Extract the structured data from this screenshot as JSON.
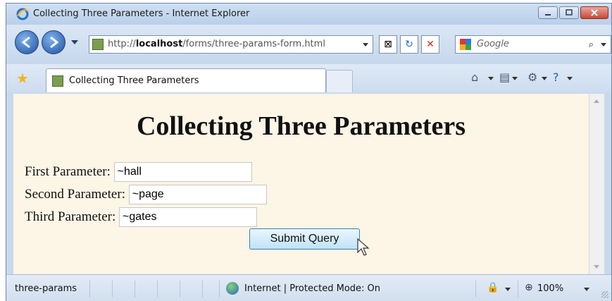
{
  "window": {
    "title": "Collecting Three Parameters - Internet Explorer",
    "controls": {
      "minimize": "minimize",
      "maximize": "maximize",
      "close": "close"
    }
  },
  "address_bar": {
    "url_prefix": "http://",
    "url_host": "localhost",
    "url_path": "/forms/three-params-form.html"
  },
  "search": {
    "placeholder": "Google"
  },
  "tab": {
    "label": "Collecting Three Parameters"
  },
  "page": {
    "heading": "Collecting Three Parameters",
    "fields": [
      {
        "label": "First Parameter:",
        "value": "~hall"
      },
      {
        "label": "Second Parameter:",
        "value": "~page"
      },
      {
        "label": "Third Parameter:",
        "value": "~gates"
      }
    ],
    "submit_label": "Submit Query"
  },
  "status": {
    "left_text": "three-params",
    "zone_text": "Internet | Protected Mode: On",
    "zoom": "100%"
  },
  "icons": {
    "back": "back-arrow-icon",
    "forward": "forward-arrow-icon",
    "favorites": "star-icon",
    "home": "home-icon",
    "page": "page-icon",
    "tools": "gear-icon",
    "help": "help-icon",
    "refresh": "refresh-icon",
    "stop": "stop-icon",
    "compat": "compatibility-icon"
  },
  "colors": {
    "content_bg": "#fdf5e6",
    "chrome_bg": "#c9d9ec",
    "button_bg": "#bfe3f8"
  }
}
